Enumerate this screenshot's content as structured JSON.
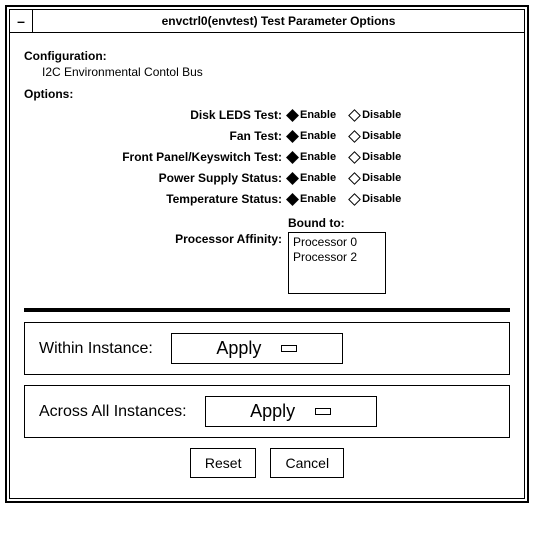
{
  "window": {
    "title": "envctrl0(envtest) Test Parameter Options"
  },
  "config": {
    "heading": "Configuration:",
    "value": "I2C Environmental Contol Bus"
  },
  "options": {
    "heading": "Options:",
    "enable_label": "Enable",
    "disable_label": "Disable",
    "rows": [
      {
        "label": "Disk LEDS Test:"
      },
      {
        "label": "Fan Test:"
      },
      {
        "label": "Front Panel/Keyswitch Test:"
      },
      {
        "label": "Power Supply Status:"
      },
      {
        "label": "Temperature Status:"
      }
    ]
  },
  "affinity": {
    "label": "Processor Affinity:",
    "bound_heading": "Bound to:",
    "items": [
      "Processor 0",
      "Processor 2"
    ]
  },
  "within": {
    "label": "Within Instance:",
    "button": "Apply"
  },
  "across": {
    "label": "Across All Instances:",
    "button": "Apply"
  },
  "buttons": {
    "reset": "Reset",
    "cancel": "Cancel"
  }
}
